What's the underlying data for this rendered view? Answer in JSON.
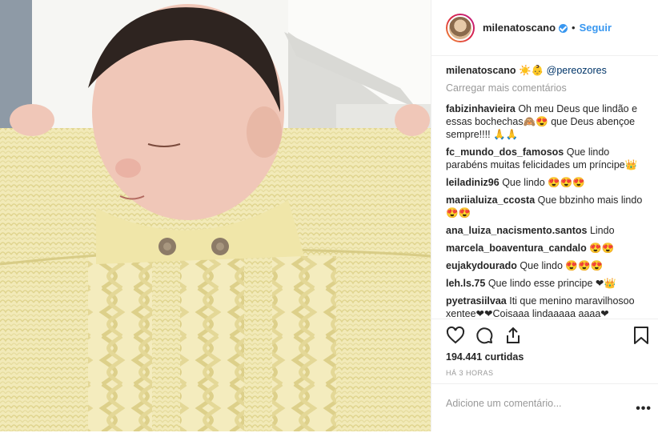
{
  "post": {
    "username": "milenatoscano",
    "follow_label": "Seguir",
    "separator": "•",
    "caption_user": "milenatoscano",
    "caption_text": "☀️👶",
    "caption_mention": "@pereozores",
    "load_more": "Carregar mais comentários",
    "likes": "194.441 curtidas",
    "time": "HÁ 3 HORAS",
    "comment_placeholder": "Adicione um comentário...",
    "more_options": "•••"
  },
  "comments": [
    {
      "user": "fabizinhavieira",
      "text": "Oh meu Deus que lindão e essas bochechas🙈😍 que Deus abençoe sempre!!!! 🙏🙏"
    },
    {
      "user": "fc_mundo_dos_famosos",
      "text": "Que lindo parabéns muitas felicidades um príncipe👑"
    },
    {
      "user": "leiladiniz96",
      "text": "Que lindo 😍😍😍"
    },
    {
      "user": "mariialuiza_ccosta",
      "text": "Que bbzinho mais lindo 😍😍"
    },
    {
      "user": "ana_luiza_nacismento.santos",
      "text": "Lindo"
    },
    {
      "user": "marcela_boaventura_candalo",
      "text": "😍😍"
    },
    {
      "user": "eujakydourado",
      "text": "Que lindo 😍😍😍"
    },
    {
      "user": "leh.ls.75",
      "text": "Que lindo esse principe ❤👑"
    },
    {
      "user": "pyetrasiilvaa",
      "text": "Iti que menino maravilhosoo xentee❤❤Coisaaa lindaaaaa aaaa❤"
    }
  ]
}
